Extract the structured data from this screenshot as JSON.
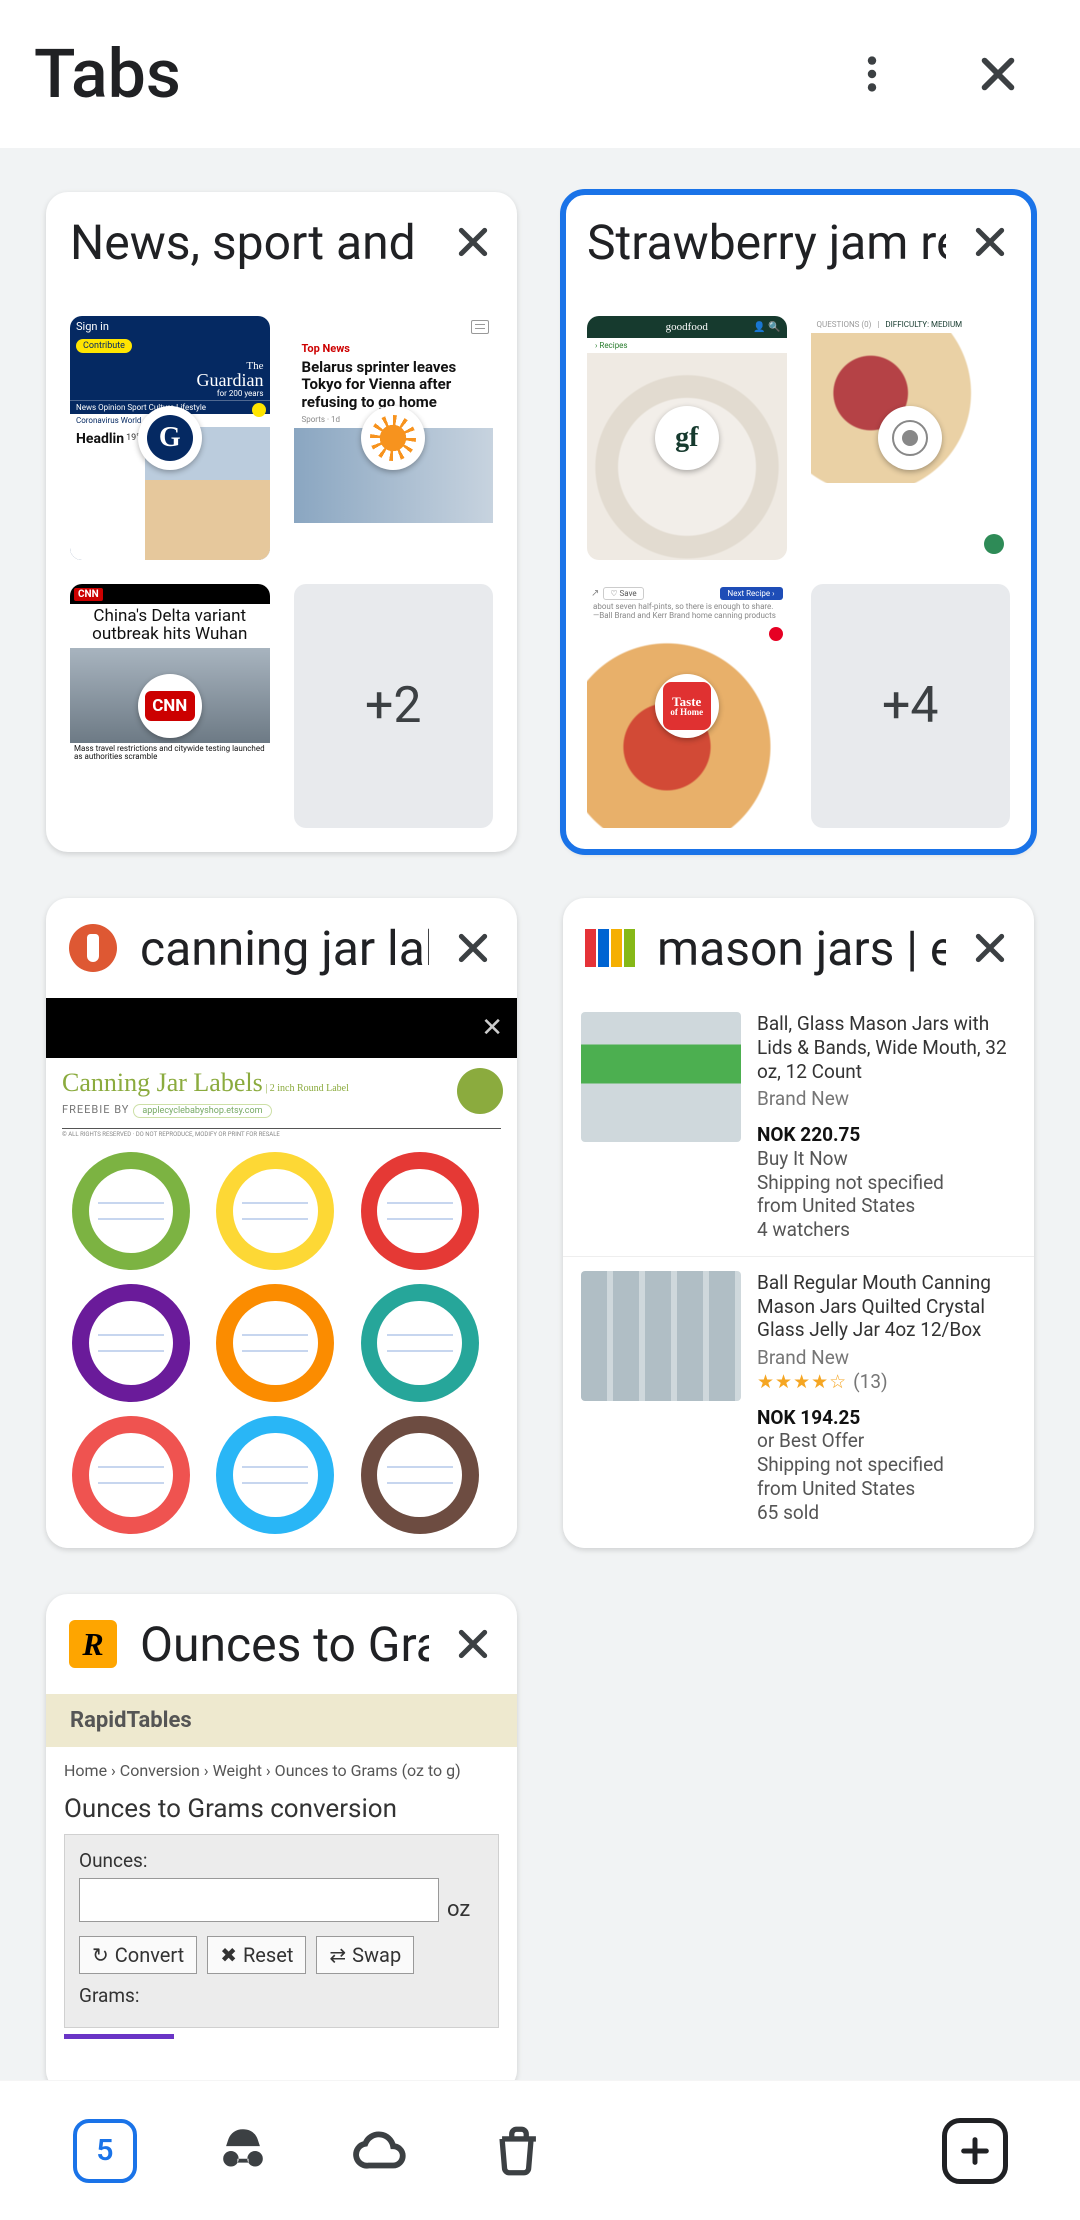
{
  "appbar": {
    "title": "Tabs"
  },
  "bottombar": {
    "tab_count": "5"
  },
  "cards": {
    "news_group": {
      "title": "News, sport and opinion",
      "more": "+2",
      "guardian": {
        "signin": "Sign in",
        "contribute": "Contribute",
        "brand": "Guardian",
        "brand_pre": "The",
        "tagline": "for 200 years",
        "nav": "News  Opinion  Sport  Culture  Lifestyle",
        "band": "Coronavirus   World",
        "headline": "Headlin",
        "temp": "19°C"
      },
      "sky": {
        "section": "Top News",
        "headline": "Belarus sprinter leaves Tokyo for Vienna after refusing to go home",
        "meta": "Sports · 1d"
      },
      "cnn": {
        "logo": "CNN",
        "headline": "China's Delta variant outbreak hits Wuhan",
        "caption": "Mass travel restrictions and citywide testing launched as authorities scramble"
      }
    },
    "jam_group": {
      "title": "Strawberry jam recipes",
      "more": "+4",
      "goodfood": {
        "brand": "goodfood",
        "crumb": "›  Recipes"
      },
      "cd": {
        "questions": "QUESTIONS (0)",
        "difficulty_label": "DIFFICULTY:",
        "difficulty_value": "MEDIUM"
      },
      "toh": {
        "save": "♡  Save",
        "next": "Next Recipe  ›",
        "blurb": "about seven half-pints, so there is enough to share. —Ball Brand and Kerr Brand home canning products"
      }
    },
    "canning": {
      "title": "canning jar labels",
      "heading": "Canning Jar Labels",
      "heading_small": " | 2 inch Round Label",
      "sub": "FREEBIE BY",
      "sub_pill": "applecyclebabyshop.etsy.com",
      "fineprint": "© ALL RIGHTS RESERVED · DO NOT REPRODUCE, MODIFY OR PRINT FOR RESALE",
      "label_colors": [
        "#7cb342",
        "#fdd835",
        "#e53935",
        "#6a1b9a",
        "#fb8c00",
        "#26a69a",
        "#ef5350",
        "#29b6f6",
        "#6d4c41"
      ]
    },
    "ebay": {
      "title": "mason jars | eBay",
      "favicon_colors": [
        "#e53238",
        "#0064d2",
        "#f5af02",
        "#86b817"
      ],
      "items": [
        {
          "title": "Ball, Glass Mason Jars with Lids &amp; Bands, Wide Mouth, 32 oz, 12 Count",
          "condition": "Brand New",
          "price": "NOK 220.75",
          "buy": "Buy It Now",
          "ship": "Shipping not specified",
          "from": "from United States",
          "extra": "4 watchers"
        },
        {
          "title": "Ball Regular Mouth Canning Mason Jars Quilted Crystal Glass Jelly Jar 4oz 12/Box",
          "condition": "Brand New",
          "stars": "★★★★☆",
          "reviews": "(13)",
          "price": "NOK 194.25",
          "buy": "or Best Offer",
          "ship": "Shipping not specified",
          "from": "from United States",
          "extra": "65 sold"
        }
      ]
    },
    "rapidtables": {
      "title": "Ounces to Grams",
      "favicon_letter": "R",
      "brand": "RapidTables",
      "crumb": "Home  ›  Conversion  ›  Weight  ›  Ounces to Grams (oz to g)",
      "h1": "Ounces to Grams conversion",
      "lbl_oz": "Ounces:",
      "unit_oz": "oz",
      "btn_convert": "Convert",
      "btn_reset": "Reset",
      "btn_swap": "Swap",
      "lbl_g": "Grams:"
    }
  }
}
